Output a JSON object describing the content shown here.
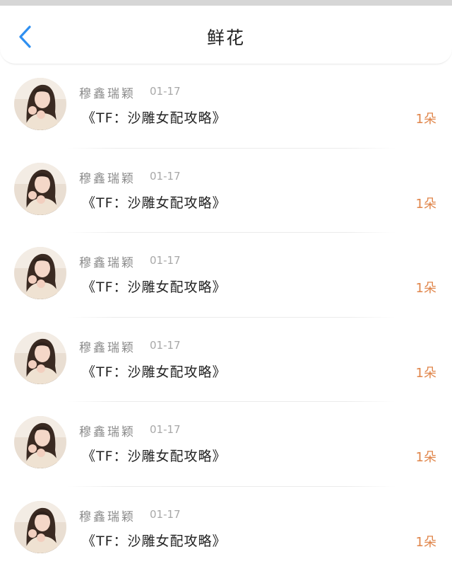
{
  "colors": {
    "accent_blue": "#2f8ff0",
    "count_orange": "#e0854a",
    "name_gray": "#8a8a8a",
    "title_dark": "#222222"
  },
  "header": {
    "back_icon": "chevron-left-icon",
    "title": "鲜花"
  },
  "items": [
    {
      "author": "穆鑫瑞颖",
      "date": "01-17",
      "title": "《TF：沙雕女配攻略》",
      "count": "1朵",
      "avatar_icon": "avatar-photo"
    },
    {
      "author": "穆鑫瑞颖",
      "date": "01-17",
      "title": "《TF：沙雕女配攻略》",
      "count": "1朵",
      "avatar_icon": "avatar-photo"
    },
    {
      "author": "穆鑫瑞颖",
      "date": "01-17",
      "title": "《TF：沙雕女配攻略》",
      "count": "1朵",
      "avatar_icon": "avatar-photo"
    },
    {
      "author": "穆鑫瑞颖",
      "date": "01-17",
      "title": "《TF：沙雕女配攻略》",
      "count": "1朵",
      "avatar_icon": "avatar-photo"
    },
    {
      "author": "穆鑫瑞颖",
      "date": "01-17",
      "title": "《TF：沙雕女配攻略》",
      "count": "1朵",
      "avatar_icon": "avatar-photo"
    },
    {
      "author": "穆鑫瑞颖",
      "date": "01-17",
      "title": "《TF：沙雕女配攻略》",
      "count": "1朵",
      "avatar_icon": "avatar-photo"
    }
  ]
}
